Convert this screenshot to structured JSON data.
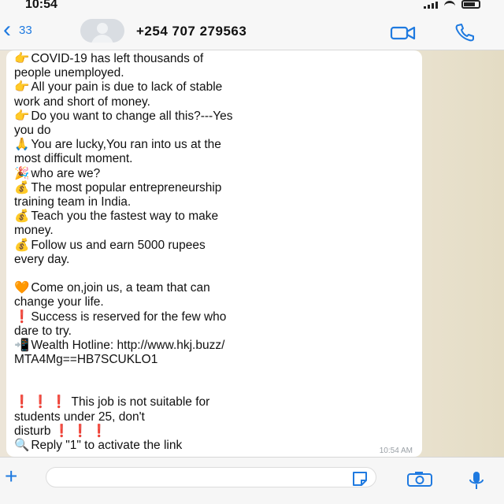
{
  "status_bar": {
    "time": "10:54"
  },
  "header": {
    "back_count": "33",
    "contact_name": "+254 707 279563"
  },
  "message": {
    "lines": [
      {
        "emoji": "👉",
        "text": "COVID-19 has left thousands of"
      },
      {
        "emoji": "",
        "text": "people unemployed."
      },
      {
        "emoji": "👉",
        "text": "All your pain is due to lack of stable"
      },
      {
        "emoji": "",
        "text": "work and short of money."
      },
      {
        "emoji": "👉",
        "text": "Do you want to change all this?---Yes"
      },
      {
        "emoji": "",
        "text": "you do"
      },
      {
        "emoji": "🙏",
        "text": "You are lucky,You ran into us at the"
      },
      {
        "emoji": "",
        "text": "most difficult moment."
      },
      {
        "emoji": "🎉",
        "text": "who are we?"
      },
      {
        "emoji": "💰",
        "text": "The most popular entrepreneurship"
      },
      {
        "emoji": "",
        "text": "training team in India."
      },
      {
        "emoji": "💰",
        "text": "Teach you the fastest way to make"
      },
      {
        "emoji": "",
        "text": "money."
      },
      {
        "emoji": "💰",
        "text": "Follow us and earn 5000 rupees"
      },
      {
        "emoji": "",
        "text": "every day."
      },
      {
        "emoji": "",
        "text": ""
      },
      {
        "emoji": "🧡",
        "text": "Come on,join us, a team that can"
      },
      {
        "emoji": "",
        "text": "change your life."
      },
      {
        "emoji": "❗",
        "text": "Success is reserved for the few who"
      },
      {
        "emoji": "",
        "text": "dare to try."
      },
      {
        "emoji": "📲",
        "text": "Wealth Hotline:  http://www.hkj.buzz/"
      },
      {
        "emoji": "",
        "text": "MTA4Mg==HB7SCUKLO1"
      },
      {
        "emoji": "",
        "text": ""
      },
      {
        "emoji": "❗ ❗ ❗",
        "text": " This job is not suitable for"
      },
      {
        "emoji": "",
        "text": "students under 25, don't"
      },
      {
        "emoji": "",
        "text": "disturb ❗ ❗ ❗"
      },
      {
        "emoji": "🔍",
        "text": "Reply \"1\" to activate the link"
      }
    ],
    "timestamp": "10:54 AM"
  },
  "input_bar": {
    "placeholder": ""
  },
  "colors": {
    "accent": "#1f7ae0",
    "bubble": "#ffffff",
    "chat_bg": "#ece5d8"
  },
  "icons": {
    "back": "chevron-left-icon",
    "video": "video-camera-icon",
    "call": "phone-icon",
    "plus": "plus-icon",
    "sticker": "sticker-icon",
    "camera": "camera-icon",
    "mic": "microphone-icon"
  }
}
